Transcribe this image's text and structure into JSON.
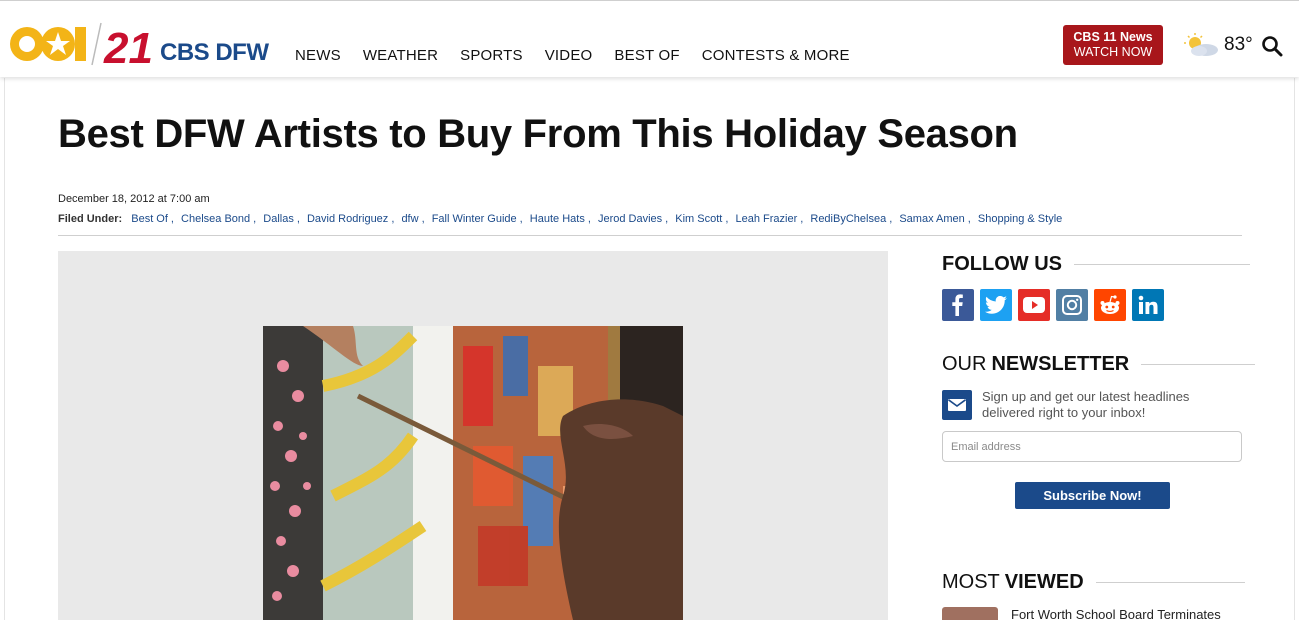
{
  "header": {
    "logo_text": "CBS DFW",
    "logo_numeral": "21",
    "nav": [
      "NEWS",
      "WEATHER",
      "SPORTS",
      "VIDEO",
      "BEST OF",
      "CONTESTS & MORE"
    ],
    "watch_line1": "CBS 11 News",
    "watch_line2": "WATCH NOW",
    "temperature": "83°",
    "colors": {
      "brand_blue": "#1b4a8a",
      "brand_red": "#a8161b",
      "logo_gold": "#f3b417"
    }
  },
  "article": {
    "title": "Best DFW Artists to Buy From This Holiday Season",
    "date": "December 18, 2012 at 7:00 am",
    "filed_label": "Filed Under:",
    "tags": [
      "Best Of",
      "Chelsea Bond",
      "Dallas",
      "David Rodriguez",
      "dfw",
      "Fall Winter Guide",
      "Haute Hats",
      "Jerod Davies",
      "Kim Scott",
      "Leah Frazier",
      "RediByChelsea",
      "Samax Amen",
      "Shopping & Style"
    ]
  },
  "sidebar": {
    "follow_title": "FOLLOW US",
    "social_icons": [
      "facebook-icon",
      "twitter-icon",
      "youtube-icon",
      "instagram-icon",
      "reddit-icon",
      "linkedin-icon"
    ],
    "newsletter_title_light": "OUR",
    "newsletter_title_bold": "NEWSLETTER",
    "newsletter_text": "Sign up and get our latest headlines delivered right to your inbox!",
    "email_placeholder": "Email address",
    "subscribe_label": "Subscribe Now!",
    "most_viewed_light": "MOST",
    "most_viewed_bold": "VIEWED",
    "most_viewed_first": "Fort Worth School Board Terminates"
  }
}
